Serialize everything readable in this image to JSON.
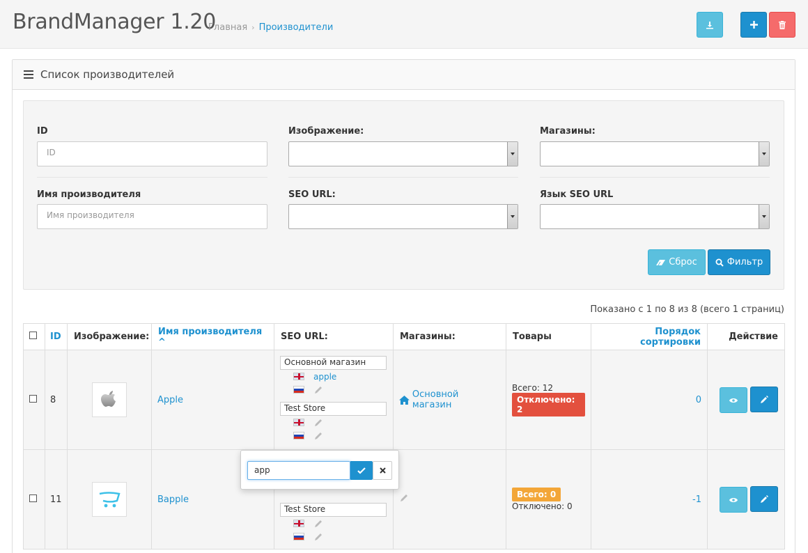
{
  "header": {
    "title": "BrandManager 1.20",
    "breadcrumb": {
      "home": "Главная",
      "separator": "›",
      "current": "Производители"
    }
  },
  "panel": {
    "title": "Список производителей"
  },
  "filter": {
    "id_label": "ID",
    "id_placeholder": "ID",
    "image_label": "Изображение:",
    "stores_label": "Магазины:",
    "name_label": "Имя производителя",
    "name_placeholder": "Имя производителя",
    "seo_label": "SEO URL:",
    "seo_lang_label": "Язык SEO URL",
    "reset_label": "Сброс",
    "filter_label": "Фильтр"
  },
  "summary": "Показано с 1 по 8 из 8 (всего 1 страниц)",
  "table": {
    "headers": {
      "id": "ID",
      "image": "Изображение:",
      "name": "Имя производителя ^",
      "seo": "SEO URL:",
      "stores": "Магазины:",
      "products": "Товары",
      "sort": "Порядок сортировки",
      "action": "Действие"
    },
    "rows": [
      {
        "id": "8",
        "name": "Apple",
        "store1": "Основной магазин",
        "store1_en_keyword": "apple",
        "store2": "Test Store",
        "stores_link": "Основной магазин",
        "products_total": "Всего: 12",
        "products_disabled": "Отключено: 2",
        "sort_order": "0"
      },
      {
        "id": "11",
        "name": "Bapple",
        "store2": "Test Store",
        "products_total": "Всего: 0",
        "products_disabled": "Отключено: 0",
        "sort_order": "-1"
      }
    ]
  },
  "popover": {
    "value": "app"
  },
  "colors": {
    "primary": "#1e91cf",
    "info": "#5bc0de",
    "danger": "#f56b6b",
    "label_red": "#e3503e",
    "label_orange": "#f3a638"
  }
}
